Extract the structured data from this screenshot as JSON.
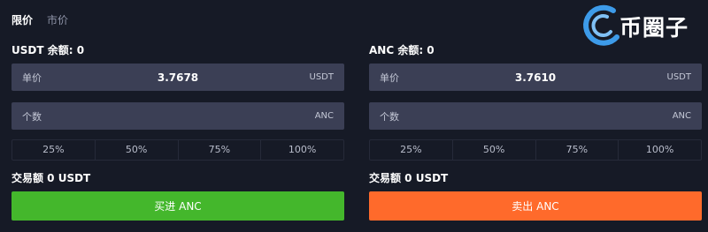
{
  "tabs": [
    {
      "label": "限价",
      "active": true
    },
    {
      "label": "市价",
      "active": false
    }
  ],
  "logo": {
    "text": "币圈子",
    "ring_color": "#3d9be9"
  },
  "buy_panel": {
    "balance_label": "USDT 余额: 0",
    "price_label": "单价",
    "price_value": "3.7678",
    "price_unit": "USDT",
    "amount_label": "个数",
    "amount_value": "",
    "amount_unit": "ANC",
    "percents": [
      "25%",
      "50%",
      "75%",
      "100%"
    ],
    "total_label": "交易额 0 USDT",
    "action_label": "买进 ANC"
  },
  "sell_panel": {
    "balance_label": "ANC 余额: 0",
    "price_label": "单价",
    "price_value": "3.7610",
    "price_unit": "USDT",
    "amount_label": "个数",
    "amount_value": "",
    "amount_unit": "ANC",
    "percents": [
      "25%",
      "50%",
      "75%",
      "100%"
    ],
    "total_label": "交易额 0 USDT",
    "action_label": "卖出 ANC"
  },
  "colors": {
    "background": "#161a26",
    "field": "#3b3f55",
    "buy": "#44b72c",
    "sell": "#ff6a2b"
  }
}
